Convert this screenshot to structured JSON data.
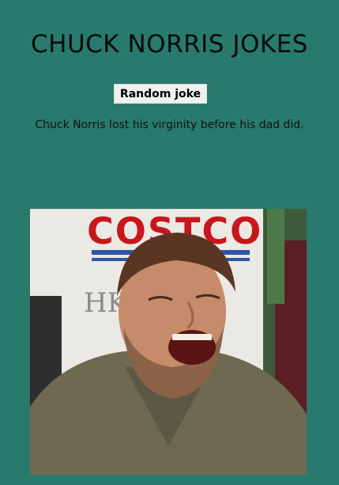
{
  "header": {
    "title": "CHUCK NORRIS JOKES"
  },
  "controls": {
    "random_button_label": "Random joke"
  },
  "joke": {
    "text": "Chuck Norris lost his virginity before his dad did."
  },
  "photo": {
    "sign_text": "COSTCO",
    "background_letters": "HK"
  },
  "colors": {
    "page_background": "#287a6d",
    "button_background": "#f0f0f0",
    "sign_red": "#c8161d",
    "sign_blue": "#2a55a8"
  }
}
